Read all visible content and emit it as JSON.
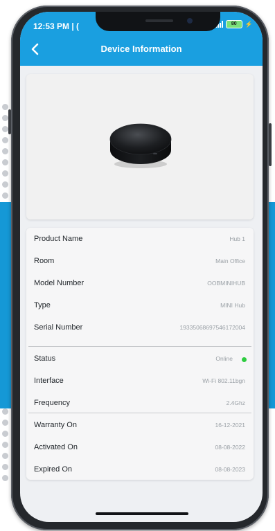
{
  "status_bar": {
    "time": "12:53 PM | (",
    "battery_label": "80"
  },
  "header": {
    "title": "Device Information",
    "back_icon": "chevron-left-icon"
  },
  "device": {
    "image": "hub-device-image"
  },
  "details": {
    "rows": [
      {
        "label": "Product Name",
        "value": "Hub 1"
      },
      {
        "label": "Room",
        "value": "Main Office"
      },
      {
        "label": "Model Number",
        "value": "OOBMINIHUB"
      },
      {
        "label": "Type",
        "value": "MINI Hub"
      },
      {
        "label": "Serial Number",
        "value": "19335068697546172004"
      },
      {
        "label": "Status",
        "value": "Online"
      },
      {
        "label": "Interface",
        "value": "Wi-Fi 802.11bgn"
      },
      {
        "label": "Frequency",
        "value": "2.4Ghz"
      },
      {
        "label": "Warranty On",
        "value": "16-12-2021"
      },
      {
        "label": "Activated On",
        "value": "08-08-2022"
      },
      {
        "label": "Expired On",
        "value": "08-08-2023"
      }
    ]
  },
  "colors": {
    "app_bar": "#1a9fe0",
    "band": "#1598d6",
    "status_online": "#2ecc40"
  }
}
